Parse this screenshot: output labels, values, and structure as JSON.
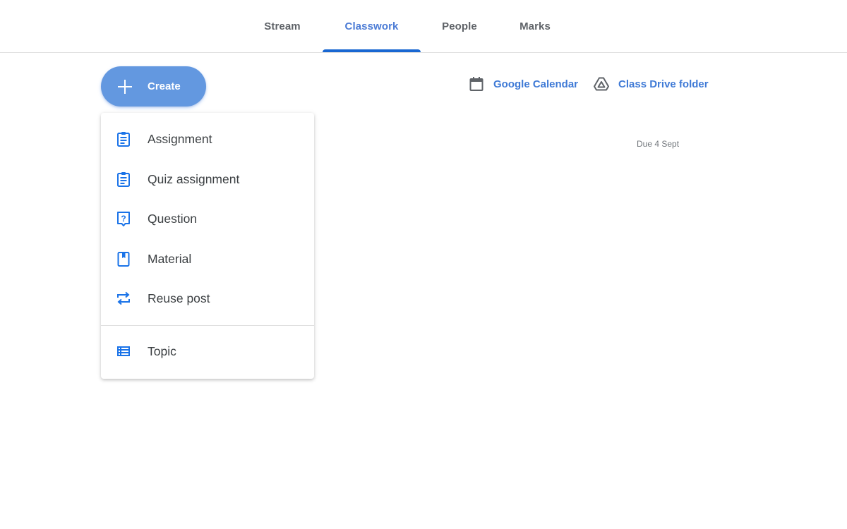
{
  "nav": {
    "tabs": [
      {
        "label": "Stream",
        "active": false
      },
      {
        "label": "Classwork",
        "active": true
      },
      {
        "label": "People",
        "active": false
      },
      {
        "label": "Marks",
        "active": false
      }
    ]
  },
  "create_button": {
    "label": "Create",
    "icon": "plus-icon"
  },
  "links": [
    {
      "label": "Google Calendar",
      "icon": "calendar-icon"
    },
    {
      "label": "Class Drive folder",
      "icon": "drive-icon"
    }
  ],
  "due_text": "Due 4 Sept",
  "create_menu": {
    "items": [
      {
        "label": "Assignment",
        "icon": "assignment-icon"
      },
      {
        "label": "Quiz assignment",
        "icon": "quiz-assignment-icon"
      },
      {
        "label": "Question",
        "icon": "question-icon"
      },
      {
        "label": "Material",
        "icon": "material-icon"
      },
      {
        "label": "Reuse post",
        "icon": "reuse-icon"
      },
      {
        "label": "Topic",
        "icon": "topic-icon"
      }
    ]
  },
  "colors": {
    "accent": "#1967d2",
    "create_button": "#6398e0",
    "link": "#3f7ad6",
    "tab_inactive": "#5f6368"
  }
}
